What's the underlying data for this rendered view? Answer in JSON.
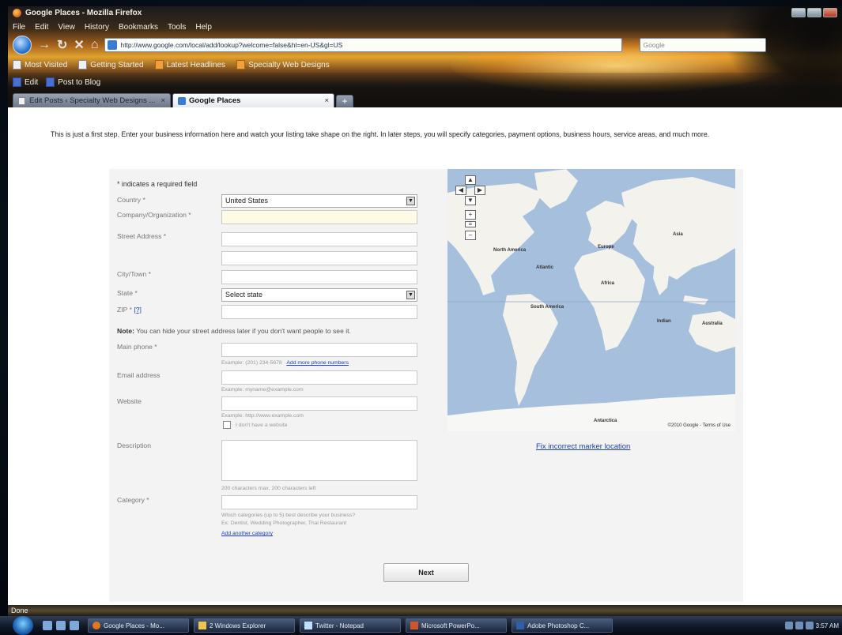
{
  "window": {
    "title": "Google Places - Mozilla Firefox"
  },
  "menubar": [
    "File",
    "Edit",
    "View",
    "History",
    "Bookmarks",
    "Tools",
    "Help"
  ],
  "navigation": {
    "url": "http://www.google.com/local/add/lookup?welcome=false&hl=en-US&gl=US",
    "search_placeholder": "Google"
  },
  "bookmarks": [
    "Most Visited",
    "Getting Started",
    "Latest Headlines",
    "Specialty Web Designs"
  ],
  "toolbar2": {
    "edit": "Edit",
    "post": "Post to Blog"
  },
  "tabs": [
    {
      "label": "Edit Posts ‹ Specialty Web Designs ..."
    },
    {
      "label": "Google Places"
    }
  ],
  "page": {
    "intro": "This is just a first step. Enter your business information here and watch your listing take shape on the right. In later steps, you will specify categories, payment options, business hours, service areas, and much more.",
    "required_note": "* indicates a required field",
    "labels": {
      "country": "Country *",
      "company": "Company/Organization *",
      "street": "Street Address *",
      "city": "City/Town *",
      "state": "State *",
      "zip": "ZIP *",
      "zip_help": "[?]",
      "main_phone": "Main phone *",
      "email": "Email address",
      "website": "Website",
      "description": "Description",
      "category": "Category *"
    },
    "country_value": "United States",
    "state_value": "Select state",
    "note_bold": "Note:",
    "note_text": "You can hide your street address later if you don't want people to see it.",
    "phone_hint": "Example: (201) 234-5678",
    "add_phone_link": "Add more phone numbers",
    "email_hint": "Example: myname@example.com",
    "website_hint": "Example: http://www.example.com",
    "no_website": "I don't have a website",
    "description_hint": "200 characters max, 200 characters left",
    "category_hint_1": "Which categories (up to 5) best describe your business?",
    "category_hint_2": "Ex: Dentist, Wedding Photographer, Thai Restaurant",
    "add_category_link": "Add another category",
    "next_button": "Next",
    "fix_marker_link": "Fix incorrect marker location",
    "map": {
      "labels": [
        "North America",
        "Atlantic",
        "Europe",
        "Asia",
        "Africa",
        "South America",
        "Indian",
        "Australia",
        "Antarctica"
      ],
      "copyright": "©2010 Google - Terms of Use",
      "ocean_color": "#a5bfdd",
      "land_color": "#f4f2ec"
    }
  },
  "status": "Done",
  "taskbar": {
    "tasks": [
      "Google Places - Mo...",
      "2 Windows Explorer",
      "Twitter - Notepad",
      "Microsoft PowerPo...",
      "Adobe Photoshop C..."
    ],
    "clock": "3:57 AM"
  }
}
